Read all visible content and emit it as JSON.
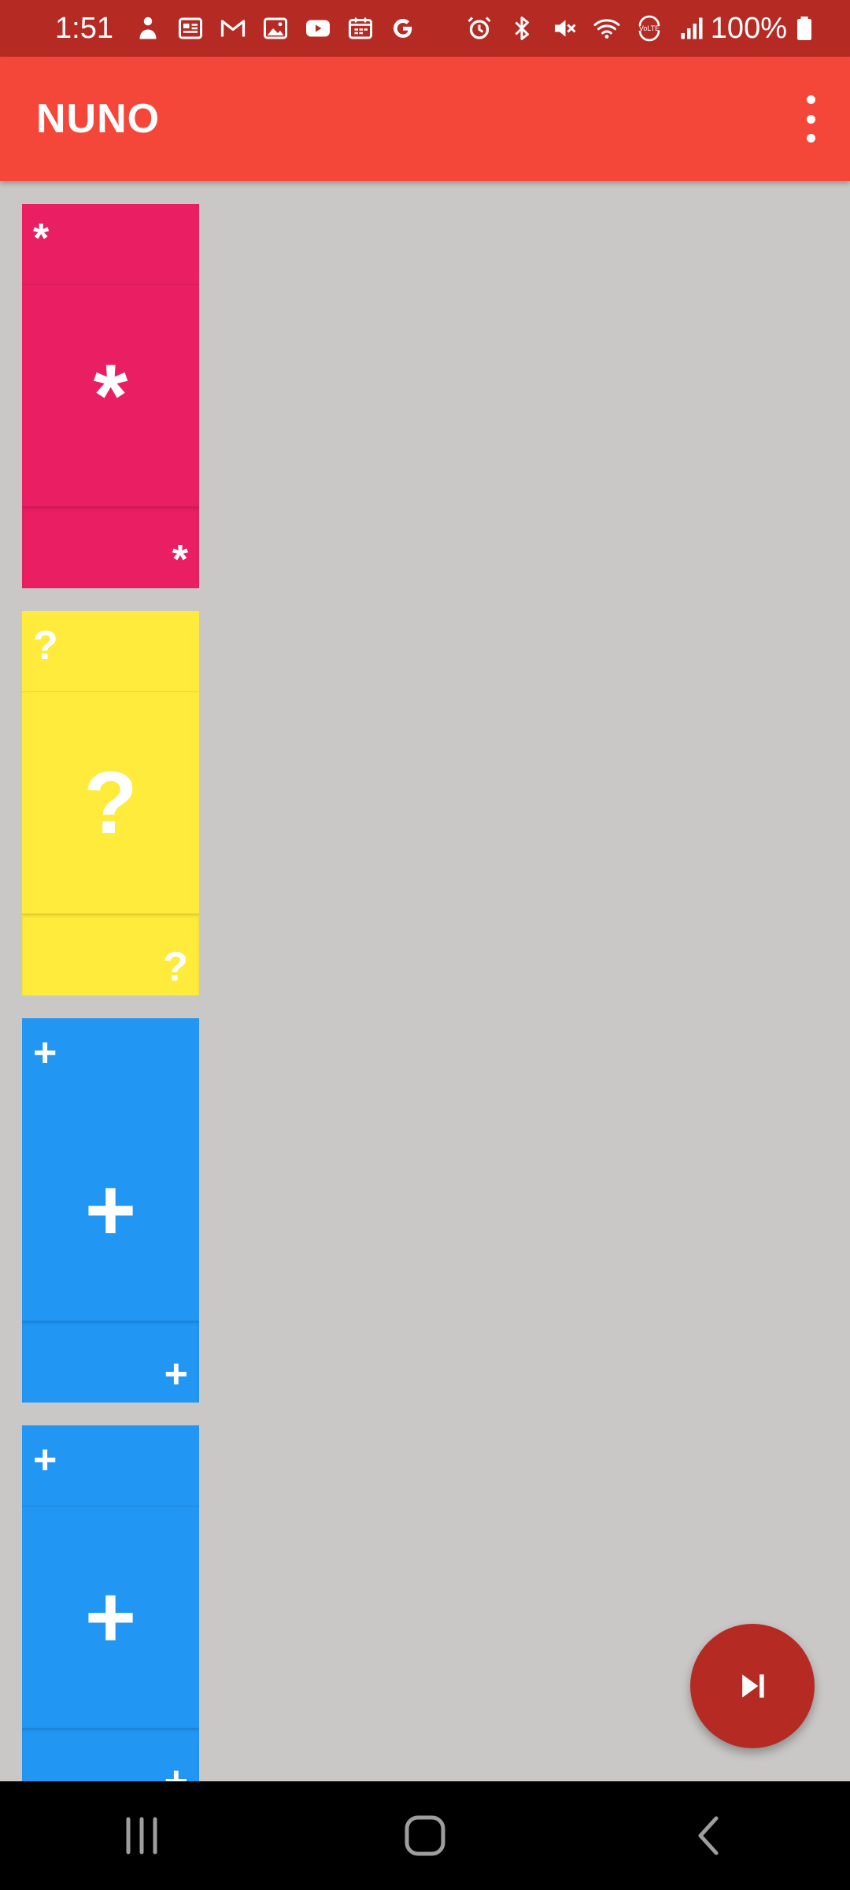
{
  "status_bar": {
    "time": "1:51",
    "battery": "100%",
    "left_icons": [
      "person-icon",
      "news-icon",
      "gmail-icon",
      "gallery-icon",
      "youtube-icon",
      "calendar-icon",
      "google-icon"
    ],
    "right_icons": [
      "alarm-icon",
      "bluetooth-icon",
      "mute-icon",
      "wifi-icon",
      "volte-icon",
      "signal-icon",
      "battery-icon"
    ]
  },
  "app_bar": {
    "title": "NUNO",
    "menu_icon": "more-vert-icon",
    "color": "#f44639"
  },
  "cards": [
    {
      "symbol": "*",
      "color": "#e91e63"
    },
    {
      "symbol": "?",
      "color": "#ffeb3b"
    },
    {
      "symbol": "+",
      "color": "#2196f3"
    },
    {
      "symbol": "+",
      "color": "#2196f3"
    }
  ],
  "fab": {
    "icon": "skip-next-icon",
    "color": "#b52b24"
  },
  "nav_bar": {
    "icons": [
      "recents-icon",
      "home-icon",
      "back-icon"
    ]
  }
}
